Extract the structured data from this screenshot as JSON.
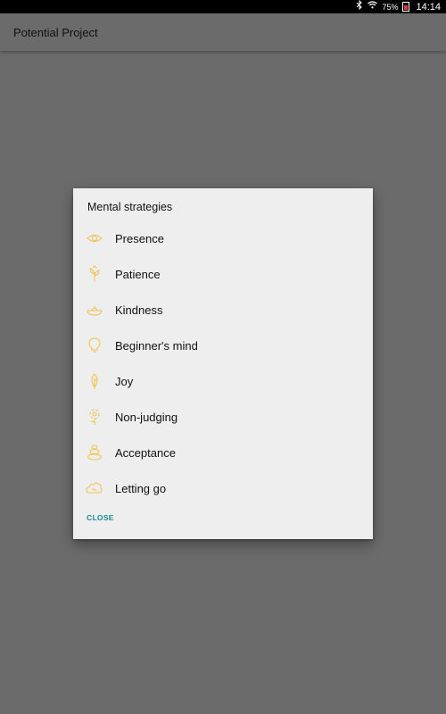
{
  "status_bar": {
    "battery_percent": "75%",
    "time": "14:14",
    "icons": [
      "bluetooth-icon",
      "wifi-icon",
      "battery-icon"
    ]
  },
  "app_bar": {
    "title": "Potential Project"
  },
  "dialog": {
    "title": "Mental strategies",
    "accent_color": "#f2c04a",
    "action_color": "#1a8a90",
    "options": [
      {
        "label": "Presence",
        "icon": "eye-icon"
      },
      {
        "label": "Patience",
        "icon": "sprout-icon"
      },
      {
        "label": "Kindness",
        "icon": "bowl-icon"
      },
      {
        "label": "Beginner's mind",
        "icon": "lightbulb-icon"
      },
      {
        "label": "Joy",
        "icon": "leaf-icon"
      },
      {
        "label": "Non-judging",
        "icon": "flower-icon"
      },
      {
        "label": "Acceptance",
        "icon": "stones-icon"
      },
      {
        "label": "Letting go",
        "icon": "cloud-icon"
      }
    ],
    "close_label": "CLOSE"
  }
}
